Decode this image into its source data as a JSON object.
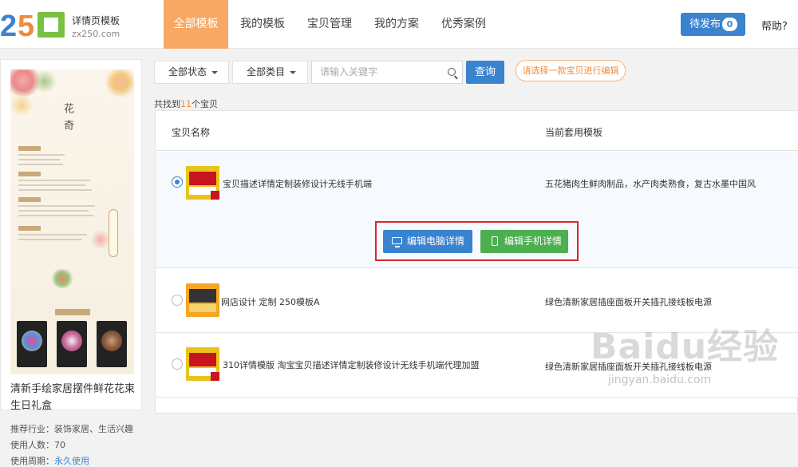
{
  "logo": {
    "number": "250",
    "subtitle": "详情页模板",
    "domain": "zx250.com"
  },
  "nav": {
    "items": [
      "全部模板",
      "我的模板",
      "宝贝管理",
      "我的方案",
      "优秀案例"
    ],
    "active_index": 0,
    "publish_label": "待发布",
    "publish_count": "0",
    "help_label": "帮助?"
  },
  "left_card": {
    "poster_title": "花 奇",
    "product_title": "清新手绘家居摆件鲜花花束生日礼盒",
    "industry_label": "推荐行业：",
    "industry_value": "装饰家居、生活兴趣",
    "users_label": "使用人数：",
    "users_value": "70",
    "period_label": "使用周期：",
    "period_value": "永久使用"
  },
  "filters": {
    "status_label": "全部状态",
    "category_label": "全部类目",
    "search_placeholder": "请输入关键字",
    "query_label": "查询",
    "hint_text": "请选择一款宝贝进行编辑"
  },
  "result": {
    "prefix": "共找到",
    "count": "11",
    "suffix": "个宝贝"
  },
  "table": {
    "headers": {
      "name": "宝贝名称",
      "template": "当前套用模板"
    },
    "rows": [
      {
        "name": "宝贝描述详情定制装修设计无线手机端",
        "template": "五花猪肉生鲜肉制品，水产肉类熟食，复古水墨中国风",
        "selected": true
      },
      {
        "name": "网店设计 定制 250模板A",
        "template": "绿色清新家居插座面板开关插孔接线板电源",
        "selected": false
      },
      {
        "name": "310详情模版 淘宝宝贝描述详情定制装修设计无线手机端代理加盟",
        "template": "绿色清新家居插座面板开关插孔接线板电源",
        "selected": false
      }
    ],
    "actions": {
      "edit_pc": "编辑电脑详情",
      "edit_mobile": "编辑手机详情"
    }
  },
  "watermark": {
    "brand": "Baidu经验",
    "url": "jingyan.baidu.com"
  },
  "colors": {
    "accent_blue": "#3a83cf",
    "active_orange": "#f7a864",
    "green": "#4caf50",
    "highlight_red": "#e0262c"
  }
}
